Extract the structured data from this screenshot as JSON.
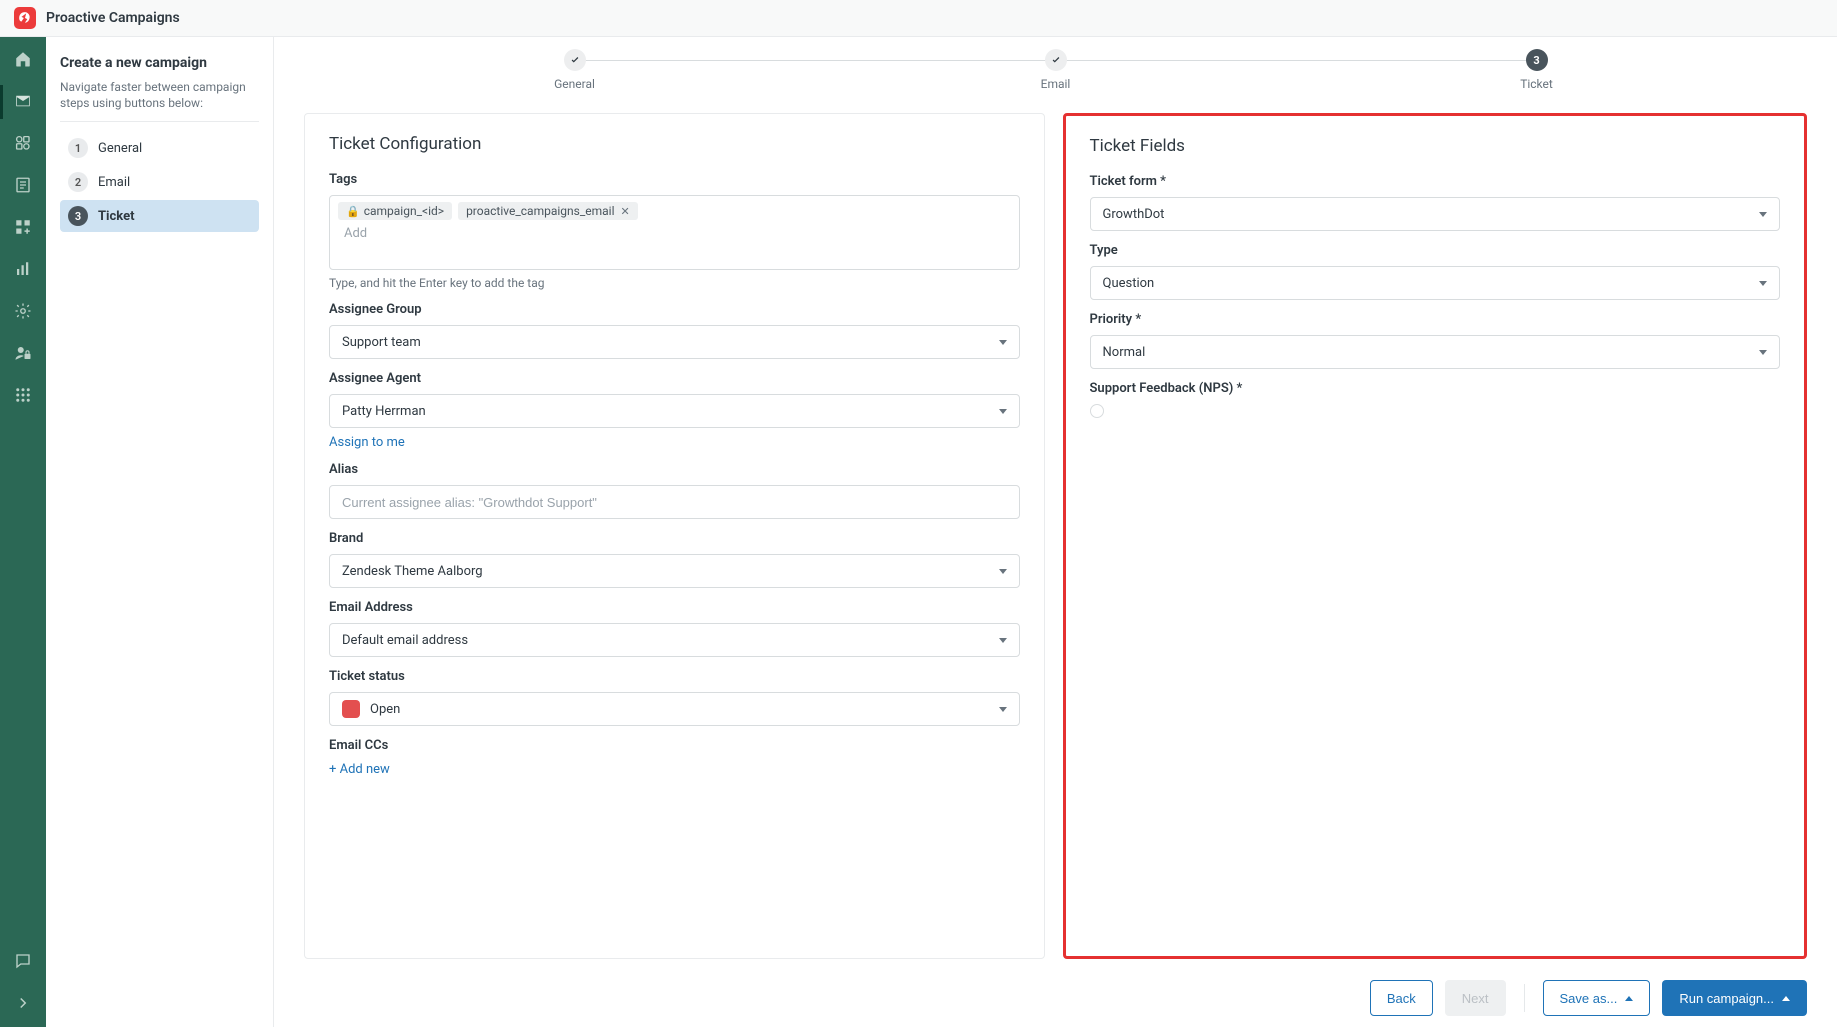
{
  "topbar": {
    "title": "Proactive Campaigns"
  },
  "sidebar": {
    "heading": "Create a new campaign",
    "hint": "Navigate faster between campaign steps using buttons below:",
    "steps": [
      {
        "num": "1",
        "label": "General"
      },
      {
        "num": "2",
        "label": "Email"
      },
      {
        "num": "3",
        "label": "Ticket"
      }
    ]
  },
  "stepper": {
    "items": [
      {
        "label": "General"
      },
      {
        "label": "Email"
      },
      {
        "label": "Ticket",
        "num": "3"
      }
    ]
  },
  "config": {
    "title": "Ticket Configuration",
    "tags": {
      "label": "Tags",
      "locked": "campaign_<id>",
      "items": [
        "proactive_campaigns_email"
      ],
      "add": "Add",
      "hint": "Type, and hit the Enter key to add the tag"
    },
    "group": {
      "label": "Assignee Group",
      "value": "Support team"
    },
    "agent": {
      "label": "Assignee Agent",
      "value": "Patty Herrman",
      "assign_link": "Assign to me"
    },
    "alias": {
      "label": "Alias",
      "placeholder": "Current assignee alias: \"Growthdot Support\""
    },
    "brand": {
      "label": "Brand",
      "value": "Zendesk Theme Aalborg"
    },
    "email": {
      "label": "Email Address",
      "value": "Default email address"
    },
    "status": {
      "label": "Ticket status",
      "value": "Open",
      "color": "#e34f4f"
    },
    "ccs": {
      "label": "Email CCs",
      "add": "Add new"
    }
  },
  "fields": {
    "title": "Ticket Fields",
    "form": {
      "label": "Ticket form *",
      "value": "GrowthDot"
    },
    "type": {
      "label": "Type",
      "value": "Question"
    },
    "priority": {
      "label": "Priority *",
      "value": "Normal"
    },
    "nps": {
      "label": "Support Feedback (NPS) *"
    }
  },
  "footer": {
    "back": "Back",
    "next": "Next",
    "save": "Save as...",
    "run": "Run campaign..."
  }
}
